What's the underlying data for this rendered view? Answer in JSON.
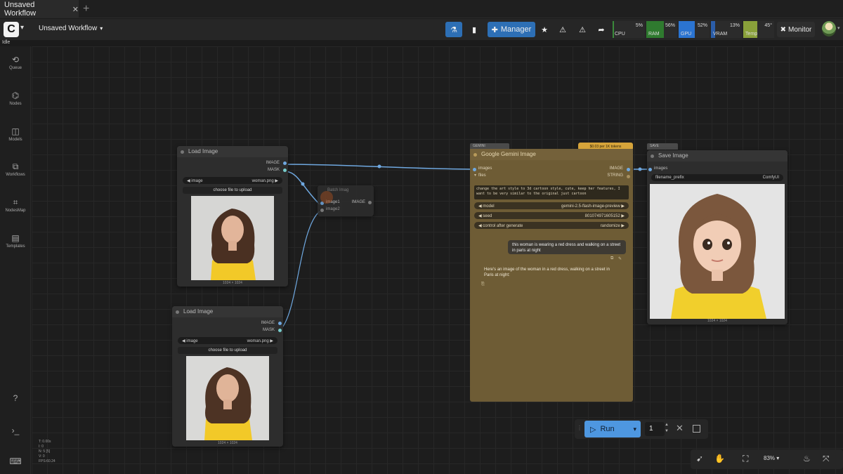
{
  "tab": {
    "title": "Unsaved Workflow"
  },
  "menubar": {
    "workflow_name": "Unsaved Workflow",
    "manager_label": "Manager",
    "monitor_label": "Monitor",
    "meters": [
      {
        "label": "CPU",
        "pct": "5%",
        "fill": 0.05,
        "color": "#3b8a3b"
      },
      {
        "label": "RAM",
        "pct": "56%",
        "fill": 0.56,
        "color": "#2f7a2f"
      },
      {
        "label": "GPU",
        "pct": "52%",
        "fill": 0.52,
        "color": "#2b74d1"
      },
      {
        "label": "VRAM",
        "pct": "13%",
        "fill": 0.13,
        "color": "#2b5da8"
      },
      {
        "label": "Temp",
        "pct": "45°",
        "fill": 0.45,
        "color": "#8aa13a"
      }
    ]
  },
  "status": "Idle",
  "sidebar": [
    {
      "label": "Queue",
      "icon": "history-icon"
    },
    {
      "label": "Nodes",
      "icon": "nodes-icon"
    },
    {
      "label": "Models",
      "icon": "models-icon"
    },
    {
      "label": "Workflows",
      "icon": "workflows-icon"
    },
    {
      "label": "NodesMap",
      "icon": "nodesmap-icon"
    },
    {
      "label": "Templates",
      "icon": "templates-icon"
    }
  ],
  "load1": {
    "title": "Load Image",
    "out_image": "IMAGE",
    "out_mask": "MASK",
    "widget_label": "image",
    "widget_value": "woman.png",
    "upload_label": "choose file to upload",
    "dims": "1024 × 1024"
  },
  "load2": {
    "title": "Load Image",
    "out_image": "IMAGE",
    "out_mask": "MASK",
    "widget_label": "image",
    "widget_value": "woman.png",
    "upload_label": "choose file to upload",
    "dims": "1024 × 1024"
  },
  "batch": {
    "title": "Batch Imag",
    "in1": "image1",
    "in2": "image2",
    "out": "IMAGE"
  },
  "gemini": {
    "badge": "$0.03 per 1K tokens",
    "header_tag": "GEMINI",
    "title": "Google Gemini Image",
    "in_images": "images",
    "in_files": "files",
    "out_image": "IMAGE",
    "out_string": "STRING",
    "prompt": "change the art style to 3d cartoon style, cute, keep her features, I want to be very similar to the original just cartoon",
    "model_label": "model",
    "model_value": "gemini-2.5-flash-image-preview",
    "seed_label": "seed",
    "seed_value": "801074971605152",
    "cag_label": "control after generate",
    "cag_value": "randomize",
    "user_msg": "this woman is wearing a red dress and walking on a street in paris at night",
    "reply": "Here's an image of the woman in a red dress, walking on a street in Paris at night:"
  },
  "save": {
    "header_tag": "SAVE",
    "title": "Save Image",
    "in_images": "images",
    "prefix_label": "filename_prefix",
    "prefix_value": "ComfyUI",
    "dims": "1024 × 1024"
  },
  "run": {
    "label": "Run",
    "count": "1"
  },
  "bottom": {
    "zoom": "83%"
  },
  "stats": [
    "T: 0.00s",
    "I: 0",
    "N: 5 [5]",
    "V: 0",
    "FPS:60.24"
  ]
}
